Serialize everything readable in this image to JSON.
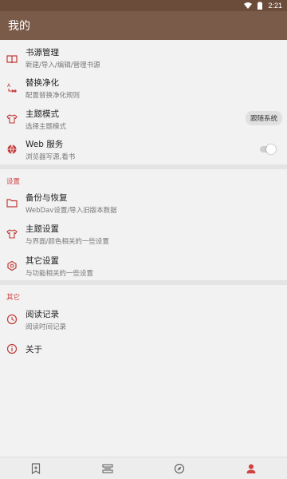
{
  "statusbar": {
    "time": "2:21"
  },
  "appbar": {
    "title": "我的"
  },
  "colors": {
    "accent": "#d04040",
    "appbar": "#7a5a48",
    "statusbar": "#6b4c3b"
  },
  "items_top": [
    {
      "title": "书源管理",
      "subtitle": "新建/导入/编辑/管理书源",
      "icon": "book-icon"
    },
    {
      "title": "替换净化",
      "subtitle": "配置替换净化规则",
      "icon": "replace-icon"
    },
    {
      "title": "主题模式",
      "subtitle": "选择主题模式",
      "icon": "shirt-icon",
      "chip": "跟随系统"
    },
    {
      "title": "Web 服务",
      "subtitle": "浏览器写源,看书",
      "icon": "globe-icon",
      "toggle": false
    }
  ],
  "section_settings": {
    "header": "设置",
    "items": [
      {
        "title": "备份与恢复",
        "subtitle": "WebDav设置/导入旧版本数据",
        "icon": "folder-icon"
      },
      {
        "title": "主题设置",
        "subtitle": "与界面/颜色相关的一些设置",
        "icon": "shirt-icon"
      },
      {
        "title": "其它设置",
        "subtitle": "与功能相关的一些设置",
        "icon": "settings-icon"
      }
    ]
  },
  "section_other": {
    "header": "其它",
    "items": [
      {
        "title": "阅读记录",
        "subtitle": "阅读时间记录",
        "icon": "clock-icon"
      },
      {
        "title": "关于",
        "icon": "info-icon"
      }
    ]
  },
  "bottom_nav": [
    {
      "name": "bookshelf",
      "icon": "bookmark-add-icon",
      "active": false
    },
    {
      "name": "explore-sources",
      "icon": "sources-icon",
      "active": false
    },
    {
      "name": "discover",
      "icon": "compass-icon",
      "active": false
    },
    {
      "name": "my",
      "icon": "person-icon",
      "active": true
    }
  ]
}
